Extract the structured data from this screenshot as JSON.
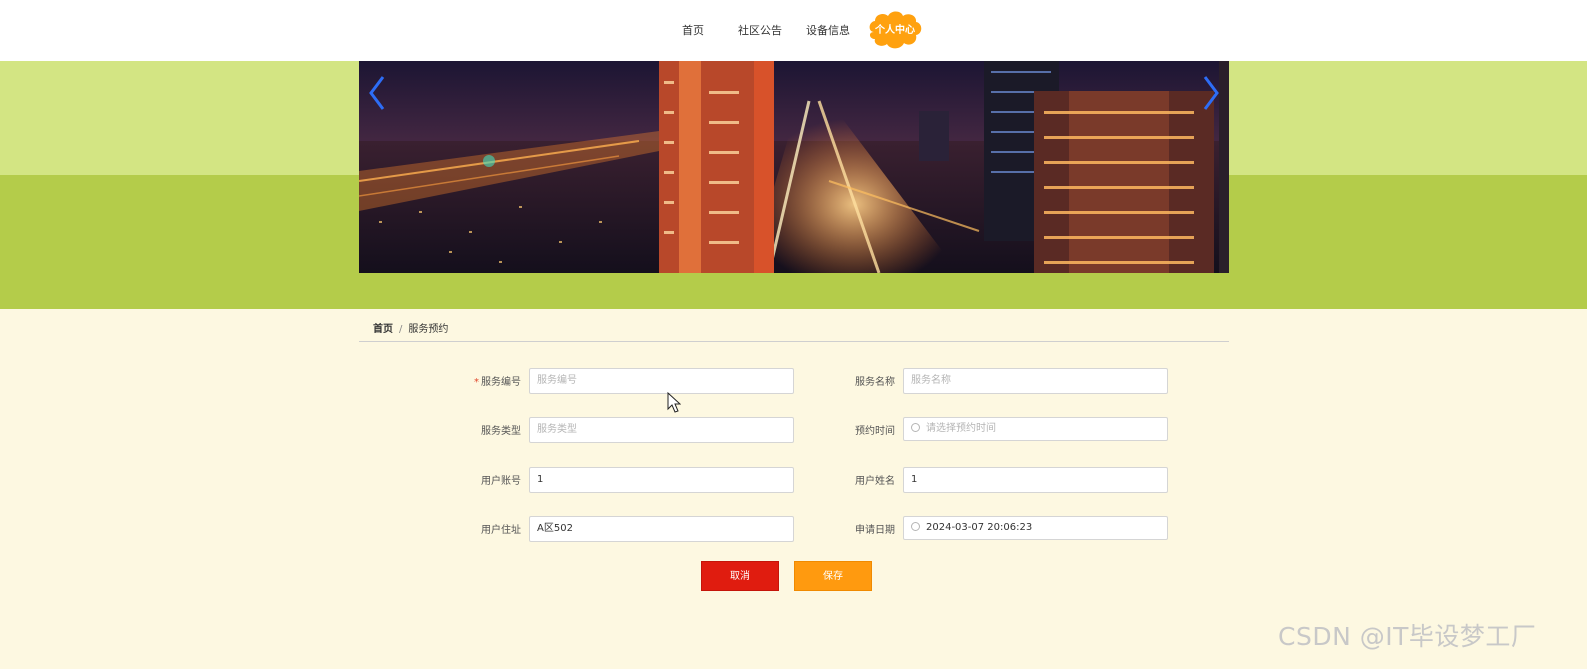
{
  "nav": {
    "items": [
      "首页",
      "社区公告",
      "设备信息"
    ],
    "active": "个人中心"
  },
  "colors": {
    "accent_orange": "#ff9a0f",
    "cancel_red": "#e01c0f",
    "band_light": "#d3e583",
    "band_dark": "#b4cc4a",
    "page_bg": "#fdf8e1"
  },
  "banner": {
    "prev_icon": "chevron-left-icon",
    "next_icon": "chevron-right-icon"
  },
  "breadcrumb": {
    "home": "首页",
    "separator": "/",
    "current": "服务预约"
  },
  "form": {
    "service_no": {
      "label": "服务编号",
      "placeholder": "服务编号",
      "value": "",
      "required": "*"
    },
    "service_name": {
      "label": "服务名称",
      "placeholder": "服务名称",
      "value": ""
    },
    "service_type": {
      "label": "服务类型",
      "placeholder": "服务类型",
      "value": ""
    },
    "reserve_time": {
      "label": "预约时间",
      "placeholder": "请选择预约时间",
      "value": ""
    },
    "user_account": {
      "label": "用户账号",
      "value": "1"
    },
    "user_name": {
      "label": "用户姓名",
      "value": "1"
    },
    "user_address": {
      "label": "用户住址",
      "value": "A区502"
    },
    "apply_date": {
      "label": "申请日期",
      "value": "2024-03-07 20:06:23"
    }
  },
  "buttons": {
    "cancel": "取消",
    "save": "保存"
  },
  "watermark": "CSDN @IT毕设梦工厂"
}
